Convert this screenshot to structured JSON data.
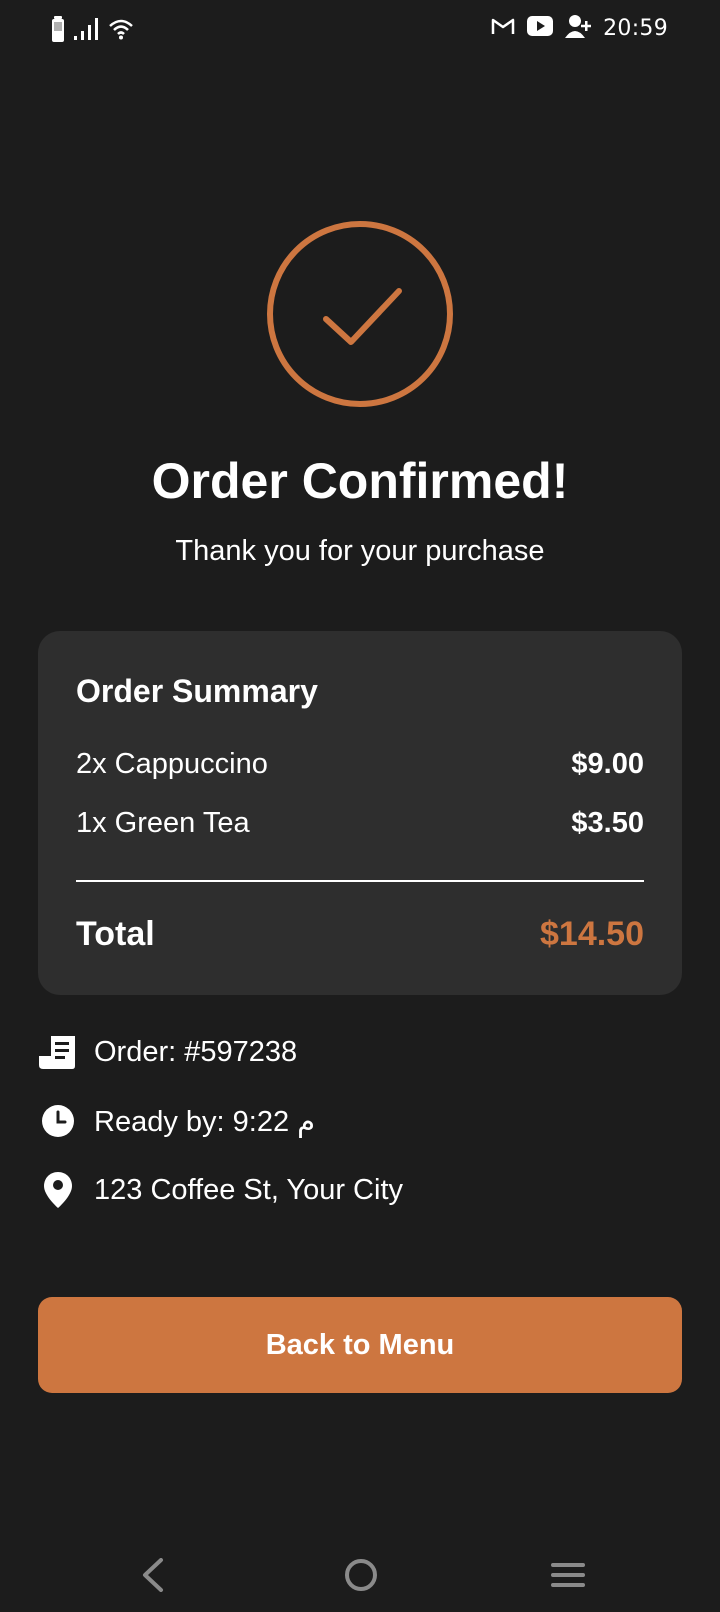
{
  "status_bar": {
    "time": "20:59",
    "left_icons": [
      "battery-icon",
      "signal-icon",
      "wifi-icon"
    ],
    "right_icons": [
      "gmail-icon",
      "youtube-icon",
      "account-add-icon"
    ]
  },
  "confirmation": {
    "icon": "check-circle-icon",
    "title": "Order Confirmed!",
    "subtitle": "Thank you for your purchase"
  },
  "summary": {
    "title": "Order Summary",
    "items": [
      {
        "label": "2x Cappuccino",
        "price": "$9.00"
      },
      {
        "label": "1x Green Tea",
        "price": "$3.50"
      }
    ],
    "total_label": "Total",
    "total_value": "$14.50"
  },
  "details": [
    {
      "icon": "receipt-icon",
      "text": "Order: #597238"
    },
    {
      "icon": "clock-icon",
      "text": "Ready by: 9:22 م"
    },
    {
      "icon": "location-pin-icon",
      "text": "123 Coffee St, Your City"
    }
  ],
  "actions": {
    "back_label": "Back to Menu"
  },
  "nav_bar": {
    "buttons": [
      "back-icon",
      "home-icon",
      "menu-icon"
    ]
  },
  "colors": {
    "accent": "#cd7640",
    "background": "#1c1c1c",
    "card": "#2e2e2e",
    "text": "#ffffff"
  }
}
